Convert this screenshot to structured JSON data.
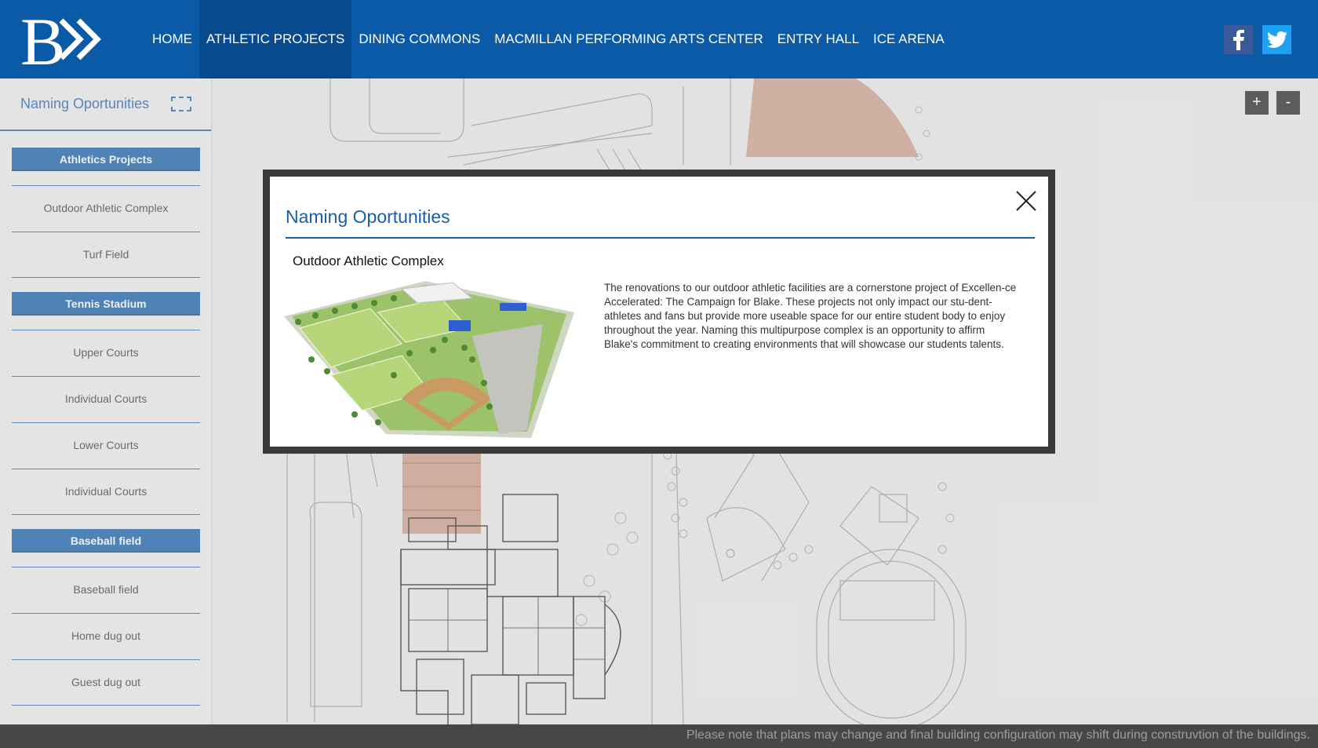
{
  "header": {
    "logo_alt": "B",
    "nav": [
      "HOME",
      "ATHLETIC PROJECTS",
      "DINING COMMONS",
      "MACMILLAN PERFORMING ARTS CENTER",
      "ENTRY HALL",
      "ICE ARENA"
    ],
    "active_nav": "ATHLETIC PROJECTS",
    "social": {
      "facebook": "f",
      "twitter": "twitter"
    }
  },
  "sidebar": {
    "title": "Naming Oportunities",
    "groups": [
      {
        "category": "Athletics Projects",
        "items": [
          "Outdoor Athletic Complex",
          "Turf Field"
        ]
      },
      {
        "category": "Tennis Stadium",
        "items": [
          "Upper Courts",
          "Individual Courts",
          "Lower Courts",
          "Individual Courts"
        ]
      },
      {
        "category": "Baseball field",
        "items": [
          "Baseball field",
          "Home dug out",
          "Guest dug out"
        ]
      }
    ]
  },
  "map": {
    "zoom_in": "+",
    "zoom_out": "-"
  },
  "modal": {
    "title": "Naming Oportunities",
    "subtitle": "Outdoor Athletic Complex",
    "body": "The renovations to our outdoor athletic facilities are a cornerstone project of Excellen-ce Accelerated: The Campaign for Blake. These projects not only impact our stu-dent-athletes and fans but provide more useable space for our entire student body to enjoy throughout the year. Naming this multipurpose complex is an opportunity to affirm Blake's commitment to creating environments that will showcase our students talents."
  },
  "footer": {
    "note": "Please note that plans may change and final building configuration may shift during construvtion of the buildings."
  },
  "colors": {
    "brand_blue": "#0a5aa8",
    "active_nav": "#074a8d",
    "modal_frame": "#3a3a3a",
    "highlight_field": "#c8866e"
  }
}
